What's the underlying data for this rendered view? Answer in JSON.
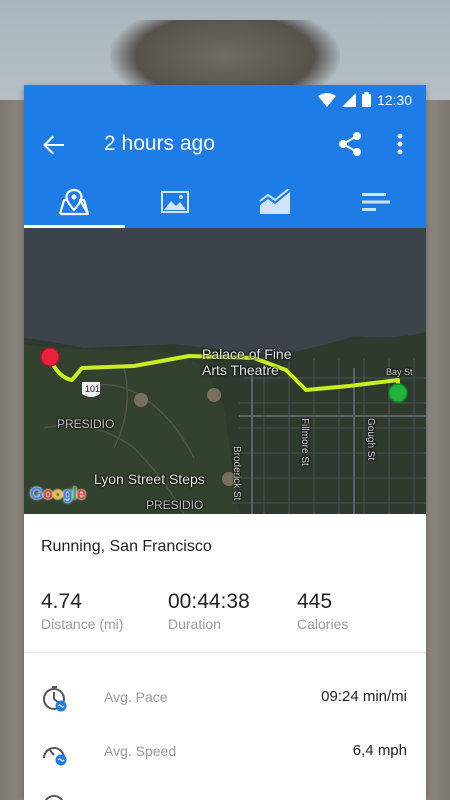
{
  "status_bar": {
    "time": "12:30",
    "wifi_icon": "wifi-icon",
    "signal_icon": "cell-signal-icon",
    "battery_icon": "battery-icon"
  },
  "app_bar": {
    "title": "2 hours ago",
    "back_icon": "arrow-back-icon",
    "share_icon": "share-icon",
    "more_icon": "more-vert-icon"
  },
  "tabs": [
    {
      "icon": "map-pin-icon",
      "active": true
    },
    {
      "icon": "image-icon",
      "active": false
    },
    {
      "icon": "chart-icon",
      "active": false
    },
    {
      "icon": "list-bars-icon",
      "active": false
    }
  ],
  "map": {
    "labels": {
      "palace": "Palace of Fine\nArts Theatre",
      "presidio_top": "PRESIDIO",
      "presidio_bottom": "PRESIDIO",
      "lyon": "Lyon Street Steps",
      "street1": "Broderick St",
      "street2": "Fillmore St",
      "street3": "Gough St",
      "highway": "101",
      "bay": "Bay St"
    },
    "attribution": "Google",
    "start_color": "#22b33a",
    "end_color": "#e8233f",
    "route_color": "#c9ee24"
  },
  "activity": {
    "title": "Running, San Francisco"
  },
  "stats": [
    {
      "value": "4.74",
      "caption": "Distance (mi)"
    },
    {
      "value": "00:44:38",
      "caption": "Duration"
    },
    {
      "value": "445",
      "caption": "Calories"
    }
  ],
  "metrics": [
    {
      "label": "Avg. Pace",
      "value": "09:24 min/mi",
      "icon": "pace-icon"
    },
    {
      "label": "Avg. Speed",
      "value": "6,4 mph",
      "icon": "speedometer-icon"
    }
  ],
  "colors": {
    "primary": "#1e7ce6"
  }
}
